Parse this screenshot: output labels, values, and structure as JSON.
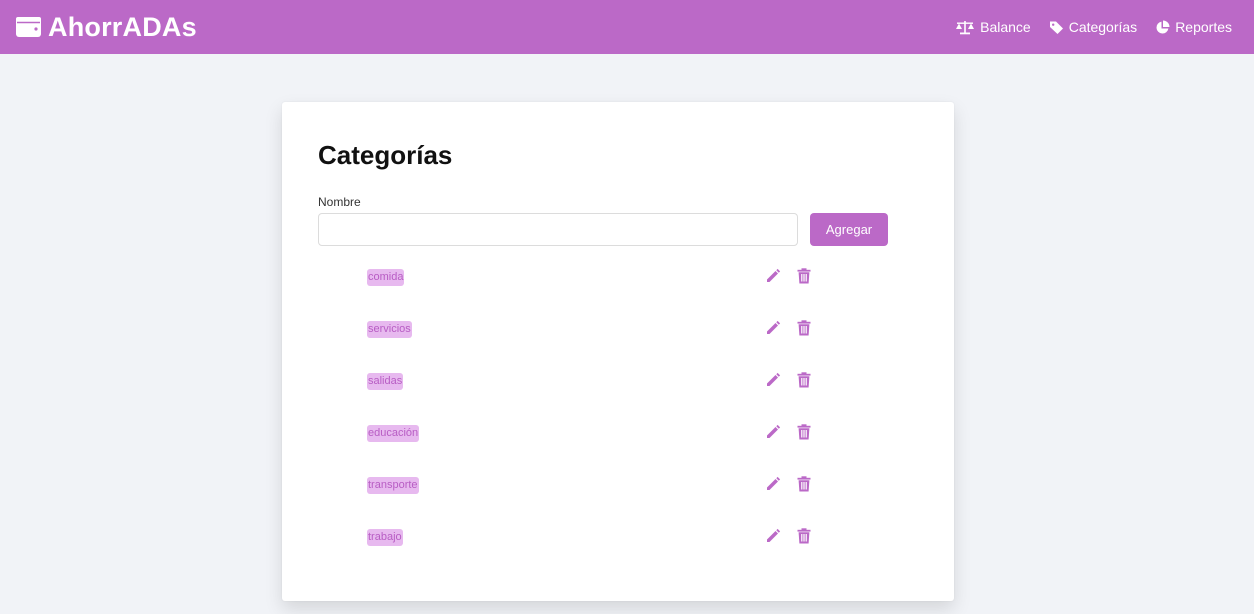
{
  "app": {
    "title": "AhorrADAs"
  },
  "nav": {
    "balance_label": "Balance",
    "categories_label": "Categorías",
    "reports_label": "Reportes"
  },
  "page": {
    "title": "Categorías",
    "name_label": "Nombre",
    "name_value": "",
    "name_placeholder": "",
    "add_label": "Agregar"
  },
  "categories": [
    "comida",
    "servicios",
    "salidas",
    "educación",
    "transporte",
    "trabajo"
  ],
  "icons": {
    "brand": "wallet-icon",
    "balance": "scale-icon",
    "categories": "tag-icon",
    "reports": "pie-chart-icon",
    "edit": "pencil-icon",
    "delete": "trash-icon"
  },
  "colors": {
    "accent": "#bb69c7",
    "background": "#f1f3f7",
    "tag_bg": "#e7b9ef",
    "tag_text": "#b85dc4"
  }
}
